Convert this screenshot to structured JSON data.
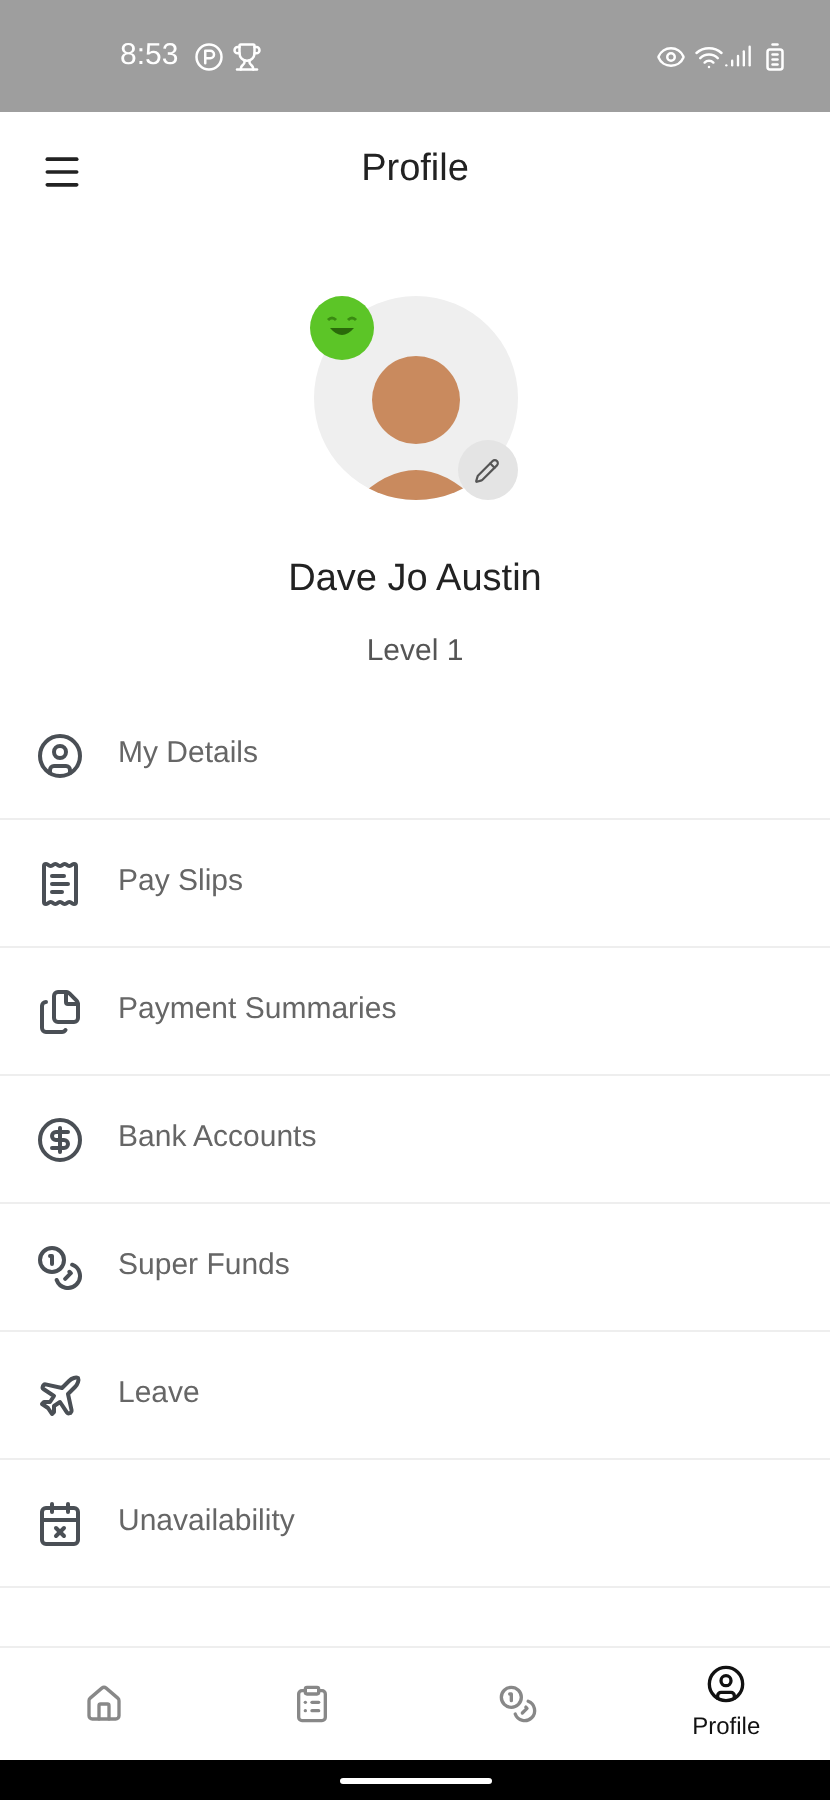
{
  "status_bar": {
    "time": "8:53"
  },
  "header": {
    "title": "Profile"
  },
  "profile": {
    "name": "Dave Jo Austin",
    "level_label": "Level 1"
  },
  "menu": [
    {
      "kind": "details",
      "label": "My Details"
    },
    {
      "kind": "payslips",
      "label": "Pay Slips"
    },
    {
      "kind": "summaries",
      "label": "Payment Summaries"
    },
    {
      "kind": "bank",
      "label": "Bank Accounts"
    },
    {
      "kind": "super",
      "label": "Super Funds"
    },
    {
      "kind": "leave",
      "label": "Leave"
    },
    {
      "kind": "unavailability",
      "label": "Unavailability"
    }
  ],
  "bottom_nav": [
    {
      "kind": "home",
      "selected": false
    },
    {
      "kind": "timesheets",
      "selected": false
    },
    {
      "kind": "pay",
      "selected": false
    },
    {
      "kind": "profile",
      "label": "Profile",
      "selected": true
    }
  ]
}
